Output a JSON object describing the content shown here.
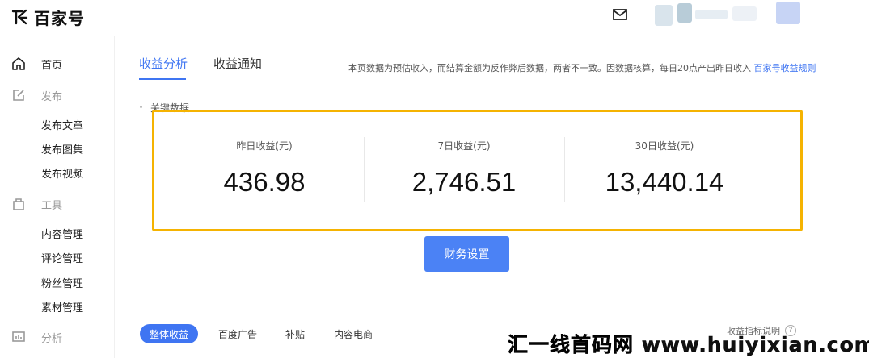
{
  "header": {
    "brand": "百家号",
    "icons": {
      "logo": "baijiahao-logo-icon",
      "mail": "mail-icon"
    },
    "colors": {
      "brand": "#111111",
      "accent": "#3f75f2"
    }
  },
  "sidebar": {
    "home": "首页",
    "publish": {
      "label": "发布",
      "items": [
        "发布文章",
        "发布图集",
        "发布视频"
      ]
    },
    "tools": {
      "label": "工具",
      "items": [
        "内容管理",
        "评论管理",
        "粉丝管理",
        "素材管理"
      ]
    },
    "analytics": "分析"
  },
  "main": {
    "tabs": [
      "收益分析",
      "收益通知"
    ],
    "notice": {
      "text": "本页数据为预估收入，而结算金额为反作弊后数据，两者不一致。因数据核算，每日20点产出昨日收入",
      "link": "百家号收益规则"
    },
    "section_title": "关键数据",
    "stats": [
      {
        "label": "昨日收益(元)",
        "value": "436.98"
      },
      {
        "label": "7日收益(元)",
        "value": "2,746.51"
      },
      {
        "label": "30日收益(元)",
        "value": "13,440.14"
      }
    ],
    "finance_button": "财务设置",
    "subtabs": [
      "整体收益",
      "百度广告",
      "补贴",
      "内容电商"
    ],
    "help": "收益指标说明",
    "help_icon": "?"
  },
  "watermark": "汇一线首码网 www.huiyixian.com",
  "highlight_color": "#f5b301"
}
